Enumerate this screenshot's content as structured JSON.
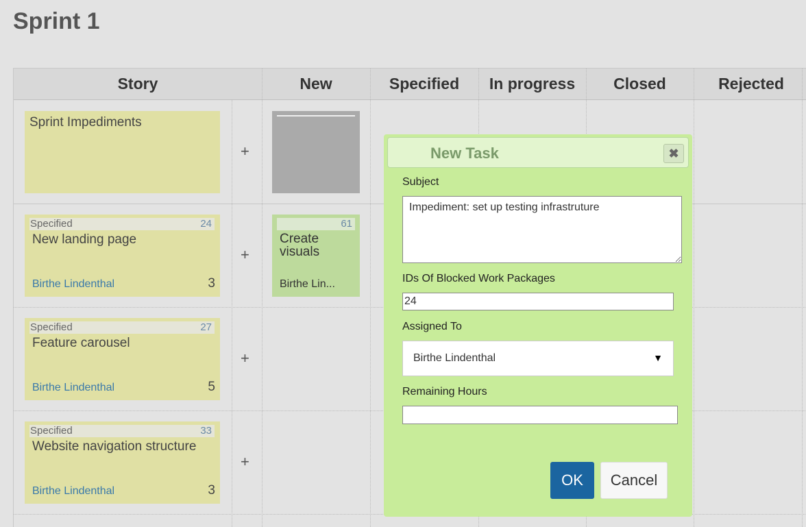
{
  "page_title": "Sprint 1",
  "columns": [
    "Story",
    "New",
    "Specified",
    "In progress",
    "Closed",
    "Rejected"
  ],
  "add_label": "+",
  "stories": [
    {
      "name": "Sprint Impediments"
    },
    {
      "status": "Specified",
      "id": "24",
      "name": "New landing page",
      "assignee": "Birthe Lindenthal",
      "points": "3"
    },
    {
      "status": "Specified",
      "id": "27",
      "name": "Feature carousel",
      "assignee": "Birthe Lindenthal",
      "points": "5"
    },
    {
      "status": "Specified",
      "id": "33",
      "name": "Website navigation structure",
      "assignee": "Birthe Lindenthal",
      "points": "3"
    }
  ],
  "tasks": [
    {
      "id": "61",
      "name": "Create visuals",
      "assignee": "Birthe Lin...",
      "color": "#bdda9c"
    }
  ],
  "dialog": {
    "title": "New Task",
    "close_icon": "close-icon",
    "subject_label": "Subject",
    "subject_value": "Impediment: set up testing infrastruture",
    "blocked_label": "IDs Of Blocked Work Packages",
    "blocked_value": "24",
    "assigned_label": "Assigned To",
    "assigned_value": "Birthe Lindenthal",
    "hours_label": "Remaining Hours",
    "hours_value": "",
    "ok_label": "OK",
    "cancel_label": "Cancel"
  },
  "colors": {
    "story": "#e0e0a4",
    "dialog": "#c8ec9a",
    "ok": "#1b65a0",
    "impediment_task": "#aaaaaa"
  }
}
